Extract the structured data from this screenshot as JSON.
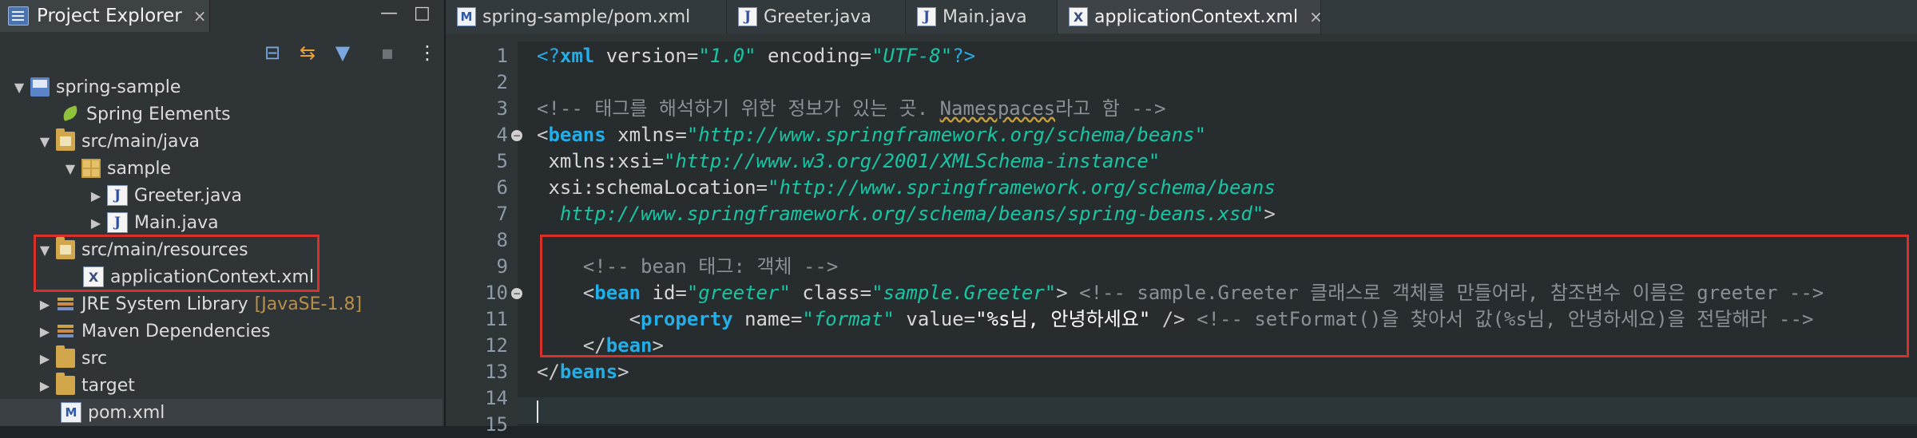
{
  "explorer": {
    "title": "Project Explorer",
    "close_icon": "×",
    "minimize_icon": "—",
    "maximize_icon": "□",
    "toolbar": {
      "collapse_icon": "⊟",
      "link_icon": "⇆",
      "filter_icon": "▼",
      "focus_icon": "▪",
      "menu_icon": "⋮"
    },
    "tree": {
      "project": "spring-sample",
      "spring_elements": "Spring Elements",
      "src_main_java": "src/main/java",
      "package": "sample",
      "greeter": "Greeter.java",
      "main": "Main.java",
      "src_main_resources": "src/main/resources",
      "app_context": "applicationContext.xml",
      "jre": "JRE System Library",
      "jre_version": "[JavaSE-1.8]",
      "maven": "Maven Dependencies",
      "src": "src",
      "target": "target",
      "pom": "pom.xml"
    }
  },
  "editor": {
    "tabs": [
      {
        "label": "spring-sample/pom.xml",
        "icon": "M"
      },
      {
        "label": "Greeter.java",
        "icon": "J"
      },
      {
        "label": "Main.java",
        "icon": "J"
      },
      {
        "label": "applicationContext.xml",
        "icon": "X",
        "active": true
      }
    ],
    "tab_close_icon": "×",
    "line_numbers": [
      "1",
      "2",
      "3",
      "4",
      "5",
      "6",
      "7",
      "8",
      "9",
      "10",
      "11",
      "12",
      "13",
      "14",
      "15"
    ],
    "fold_icon": "−",
    "code": {
      "l1_open": "<?",
      "l1_xml": "xml",
      "l1_version_attr": " version",
      "l1_eq1": "=",
      "l1_version_val": "\"1.0\"",
      "l1_encoding_attr": " encoding",
      "l1_eq2": "=",
      "l1_encoding_val": "\"UTF-8\"",
      "l1_close": "?>",
      "l3_comment_a": "<!-- 태그를 해석하기 위한 정보가 있는 곳. ",
      "l3_comment_ns": "Namespaces",
      "l3_comment_b": "라고 함 -->",
      "l4_open": "<",
      "l4_beans": "beans",
      "l4_xmlns": " xmlns",
      "l4_eq": "=",
      "l4_xmlns_val": "\"http://www.springframework.org/schema/beans\"",
      "l5_attr": " xmlns:xsi",
      "l5_eq": "=",
      "l5_val": "\"http://www.w3.org/2001/XMLSchema-instance\"",
      "l6_attr": " xsi:schemaLocation",
      "l6_eq": "=",
      "l6_val": "\"http://www.springframework.org/schema/beans",
      "l7_val": "  http://www.springframework.org/schema/beans/spring-beans.xsd\"",
      "l7_close": ">",
      "l9_comment": "    <!-- bean 태그: 객체 -->",
      "l10_indent": "    ",
      "l10_open": "<",
      "l10_bean": "bean",
      "l10_id_attr": " id",
      "l10_eq1": "=",
      "l10_id_val": "\"greeter\"",
      "l10_class_attr": " class",
      "l10_eq2": "=",
      "l10_class_val": "\"sample.Greeter\"",
      "l10_close": ">",
      "l10_comment": " <!-- sample.Greeter 클래스로 객체를 만들어라, 참조변수 이름은 greeter -->",
      "l11_indent": "        ",
      "l11_open": "<",
      "l11_property": "property",
      "l11_name_attr": " name",
      "l11_eq1": "=",
      "l11_name_val": "\"format\"",
      "l11_value_attr": " value",
      "l11_eq2": "=",
      "l11_value_val": "\"%s님, 안녕하세요\"",
      "l11_close": " />",
      "l11_comment": " <!-- setFormat()을 찾아서 값(%s님, 안녕하세요)을 전달해라 -->",
      "l12_indent": "    ",
      "l12_open": "</",
      "l12_bean": "bean",
      "l12_close": ">",
      "l13_open": "</",
      "l13_beans": "beans",
      "l13_close": ">"
    }
  },
  "colors": {
    "highlight_box": "#d8302a",
    "keyword": "#22aee8",
    "value": "#17c6a3",
    "comment": "#8a9096"
  }
}
